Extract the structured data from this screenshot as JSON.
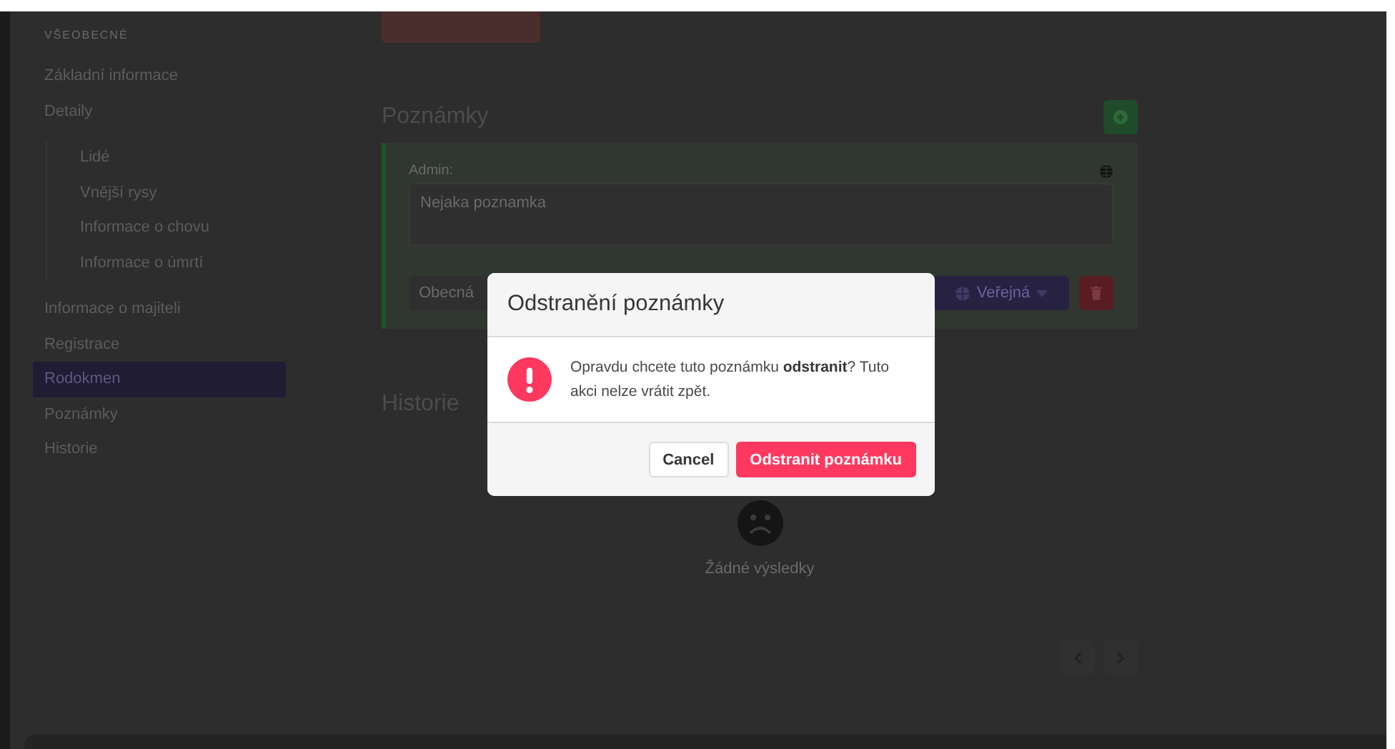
{
  "sidebar": {
    "heading": "VŠEOBECNÉ",
    "items": [
      {
        "label": "Základní informace",
        "selected": false
      },
      {
        "label": "Detaily",
        "selected": false,
        "children": [
          {
            "label": "Lidé",
            "selected": false
          },
          {
            "label": "Vnější rysy",
            "selected": false
          },
          {
            "label": "Informace o chovu",
            "selected": false
          },
          {
            "label": "Informace o úmrtí",
            "selected": false
          }
        ]
      },
      {
        "label": "Informace o majiteli",
        "selected": false
      },
      {
        "label": "Registrace",
        "selected": false
      },
      {
        "label": "Rodokmen",
        "selected": true
      },
      {
        "label": "Poznámky",
        "selected": false
      },
      {
        "label": "Historie",
        "selected": false
      }
    ]
  },
  "notes": {
    "title": "Poznámky",
    "note": {
      "author": "Admin:",
      "text": "Nejaka poznamka",
      "category": "Obecná",
      "visibility": "Veřejná"
    }
  },
  "history": {
    "title": "Historie",
    "empty": "Žádné výsledky"
  },
  "dialog": {
    "title": "Odstranění poznámky",
    "message": "Opravdu chcete tuto poznámku **odstranit**? Tuto akci nelze vrátit zpět.",
    "buttons": [
      {
        "label": "Cancel",
        "kind": "secondary"
      },
      {
        "label": "Odstranit poznámku",
        "kind": "danger"
      }
    ]
  }
}
